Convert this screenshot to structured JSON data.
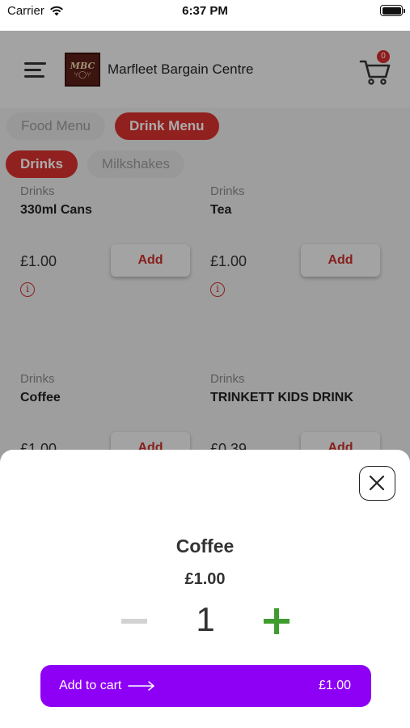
{
  "status_bar": {
    "carrier": "Carrier",
    "time": "6:37 PM"
  },
  "header": {
    "shop_name": "Marfleet Bargain Centre",
    "logo_text": "MBC",
    "cart_count": "0"
  },
  "menu_tabs": [
    {
      "label": "Food Menu",
      "active": false
    },
    {
      "label": "Drink Menu",
      "active": true
    }
  ],
  "sub_tabs": [
    {
      "label": "Drinks",
      "active": true
    },
    {
      "label": "Milkshakes",
      "active": false
    }
  ],
  "products": [
    {
      "category": "Drinks",
      "name": "330ml Cans",
      "price": "£1.00",
      "add_label": "Add"
    },
    {
      "category": "Drinks",
      "name": "Tea",
      "price": "£1.00",
      "add_label": "Add"
    },
    {
      "category": "Drinks",
      "name": "Coffee",
      "price": "£1.00",
      "add_label": "Add"
    },
    {
      "category": "Drinks",
      "name": "TRINKETT KIDS DRINK",
      "price": "£0.39",
      "add_label": "Add"
    }
  ],
  "sheet": {
    "title": "Coffee",
    "price": "£1.00",
    "quantity": "1",
    "add_to_cart_label": "Add to cart",
    "total": "£1.00"
  },
  "colors": {
    "accent_red": "#d9322e",
    "cta_purple": "#8e00f5",
    "plus_green": "#3f9d2f"
  }
}
